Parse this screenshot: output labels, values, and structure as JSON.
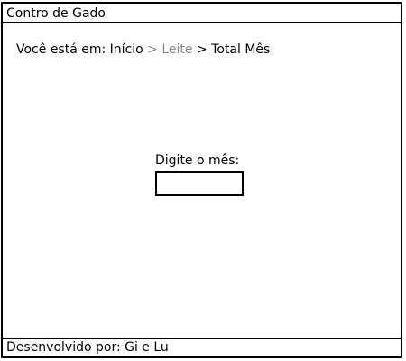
{
  "window": {
    "title": "Contro de Gado"
  },
  "breadcrumb": {
    "prefix": "Você está em: ",
    "items": [
      "Início",
      "Leite",
      "Total Mês"
    ],
    "separator": " > "
  },
  "form": {
    "month_label": "Digite o mês:",
    "month_value": ""
  },
  "footer": {
    "text": "Desenvolvido por: Gi e Lu"
  },
  "colors": {
    "border": "#000000",
    "muted_text": "#888888"
  }
}
